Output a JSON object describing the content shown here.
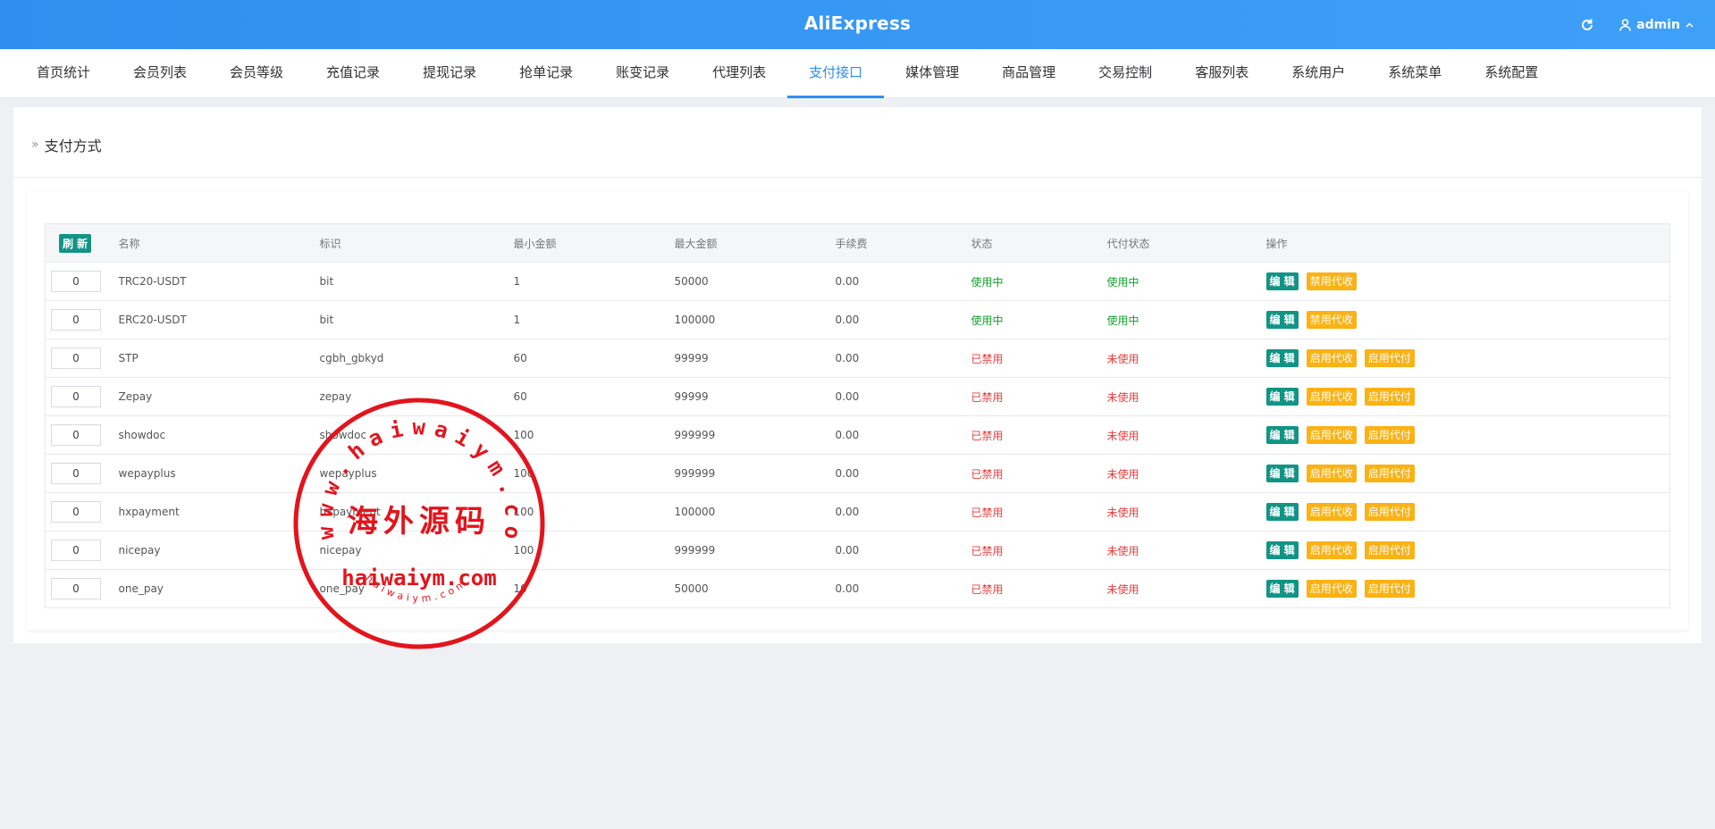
{
  "header": {
    "title": "AliExpress",
    "user": "admin"
  },
  "nav": [
    {
      "label": "首页统计"
    },
    {
      "label": "会员列表"
    },
    {
      "label": "会员等级"
    },
    {
      "label": "充值记录"
    },
    {
      "label": "提现记录"
    },
    {
      "label": "抢单记录"
    },
    {
      "label": "账变记录"
    },
    {
      "label": "代理列表"
    },
    {
      "label": "支付接口",
      "active": true
    },
    {
      "label": "媒体管理"
    },
    {
      "label": "商品管理"
    },
    {
      "label": "交易控制"
    },
    {
      "label": "客服列表"
    },
    {
      "label": "系统用户"
    },
    {
      "label": "系统菜单"
    },
    {
      "label": "系统配置"
    }
  ],
  "page": {
    "title": "支付方式"
  },
  "table": {
    "refresh_label": "刷 新",
    "headers": [
      "名称",
      "标识",
      "最小金额",
      "最大金额",
      "手续费",
      "状态",
      "代付状态",
      "操作"
    ],
    "rows": [
      {
        "sort": "0",
        "name": "TRC20-USDT",
        "code": "bit",
        "min": "1",
        "max": "50000",
        "fee": "0.00",
        "status": "使用中",
        "payout": "使用中",
        "enabled": true,
        "ops": [
          "编 辑",
          "禁用代收"
        ]
      },
      {
        "sort": "0",
        "name": "ERC20-USDT",
        "code": "bit",
        "min": "1",
        "max": "100000",
        "fee": "0.00",
        "status": "使用中",
        "payout": "使用中",
        "enabled": true,
        "ops": [
          "编 辑",
          "禁用代收"
        ]
      },
      {
        "sort": "0",
        "name": "STP",
        "code": "cgbh_gbkyd",
        "min": "60",
        "max": "99999",
        "fee": "0.00",
        "status": "已禁用",
        "payout": "未使用",
        "enabled": false,
        "ops": [
          "编 辑",
          "启用代收",
          "启用代付"
        ]
      },
      {
        "sort": "0",
        "name": "Zepay",
        "code": "zepay",
        "min": "60",
        "max": "99999",
        "fee": "0.00",
        "status": "已禁用",
        "payout": "未使用",
        "enabled": false,
        "ops": [
          "编 辑",
          "启用代收",
          "启用代付"
        ]
      },
      {
        "sort": "0",
        "name": "showdoc",
        "code": "showdoc",
        "min": "100",
        "max": "999999",
        "fee": "0.00",
        "status": "已禁用",
        "payout": "未使用",
        "enabled": false,
        "ops": [
          "编 辑",
          "启用代收",
          "启用代付"
        ]
      },
      {
        "sort": "0",
        "name": "wepayplus",
        "code": "wepayplus",
        "min": "100",
        "max": "999999",
        "fee": "0.00",
        "status": "已禁用",
        "payout": "未使用",
        "enabled": false,
        "ops": [
          "编 辑",
          "启用代收",
          "启用代付"
        ]
      },
      {
        "sort": "0",
        "name": "hxpayment",
        "code": "hxpayment",
        "min": "100",
        "max": "100000",
        "fee": "0.00",
        "status": "已禁用",
        "payout": "未使用",
        "enabled": false,
        "ops": [
          "编 辑",
          "启用代收",
          "启用代付"
        ]
      },
      {
        "sort": "0",
        "name": "nicepay",
        "code": "nicepay",
        "min": "100",
        "max": "999999",
        "fee": "0.00",
        "status": "已禁用",
        "payout": "未使用",
        "enabled": false,
        "ops": [
          "编 辑",
          "启用代收",
          "启用代付"
        ]
      },
      {
        "sort": "0",
        "name": "one_pay",
        "code": "one_pay",
        "min": "10",
        "max": "50000",
        "fee": "0.00",
        "status": "已禁用",
        "payout": "未使用",
        "enabled": false,
        "ops": [
          "编 辑",
          "启用代收",
          "启用代付"
        ]
      }
    ]
  },
  "watermark": {
    "text": "海外源码",
    "url": "haiwaiym.com",
    "ring_text": "www.haiwaiym.com",
    "small_text": "haiwaiym.com"
  },
  "colors": {
    "primary": "#2f8ff0",
    "teal": "#119485",
    "warn": "#fbb215",
    "on": "#12a12a",
    "off": "#e83b3b",
    "stamp": "#e3141c"
  }
}
